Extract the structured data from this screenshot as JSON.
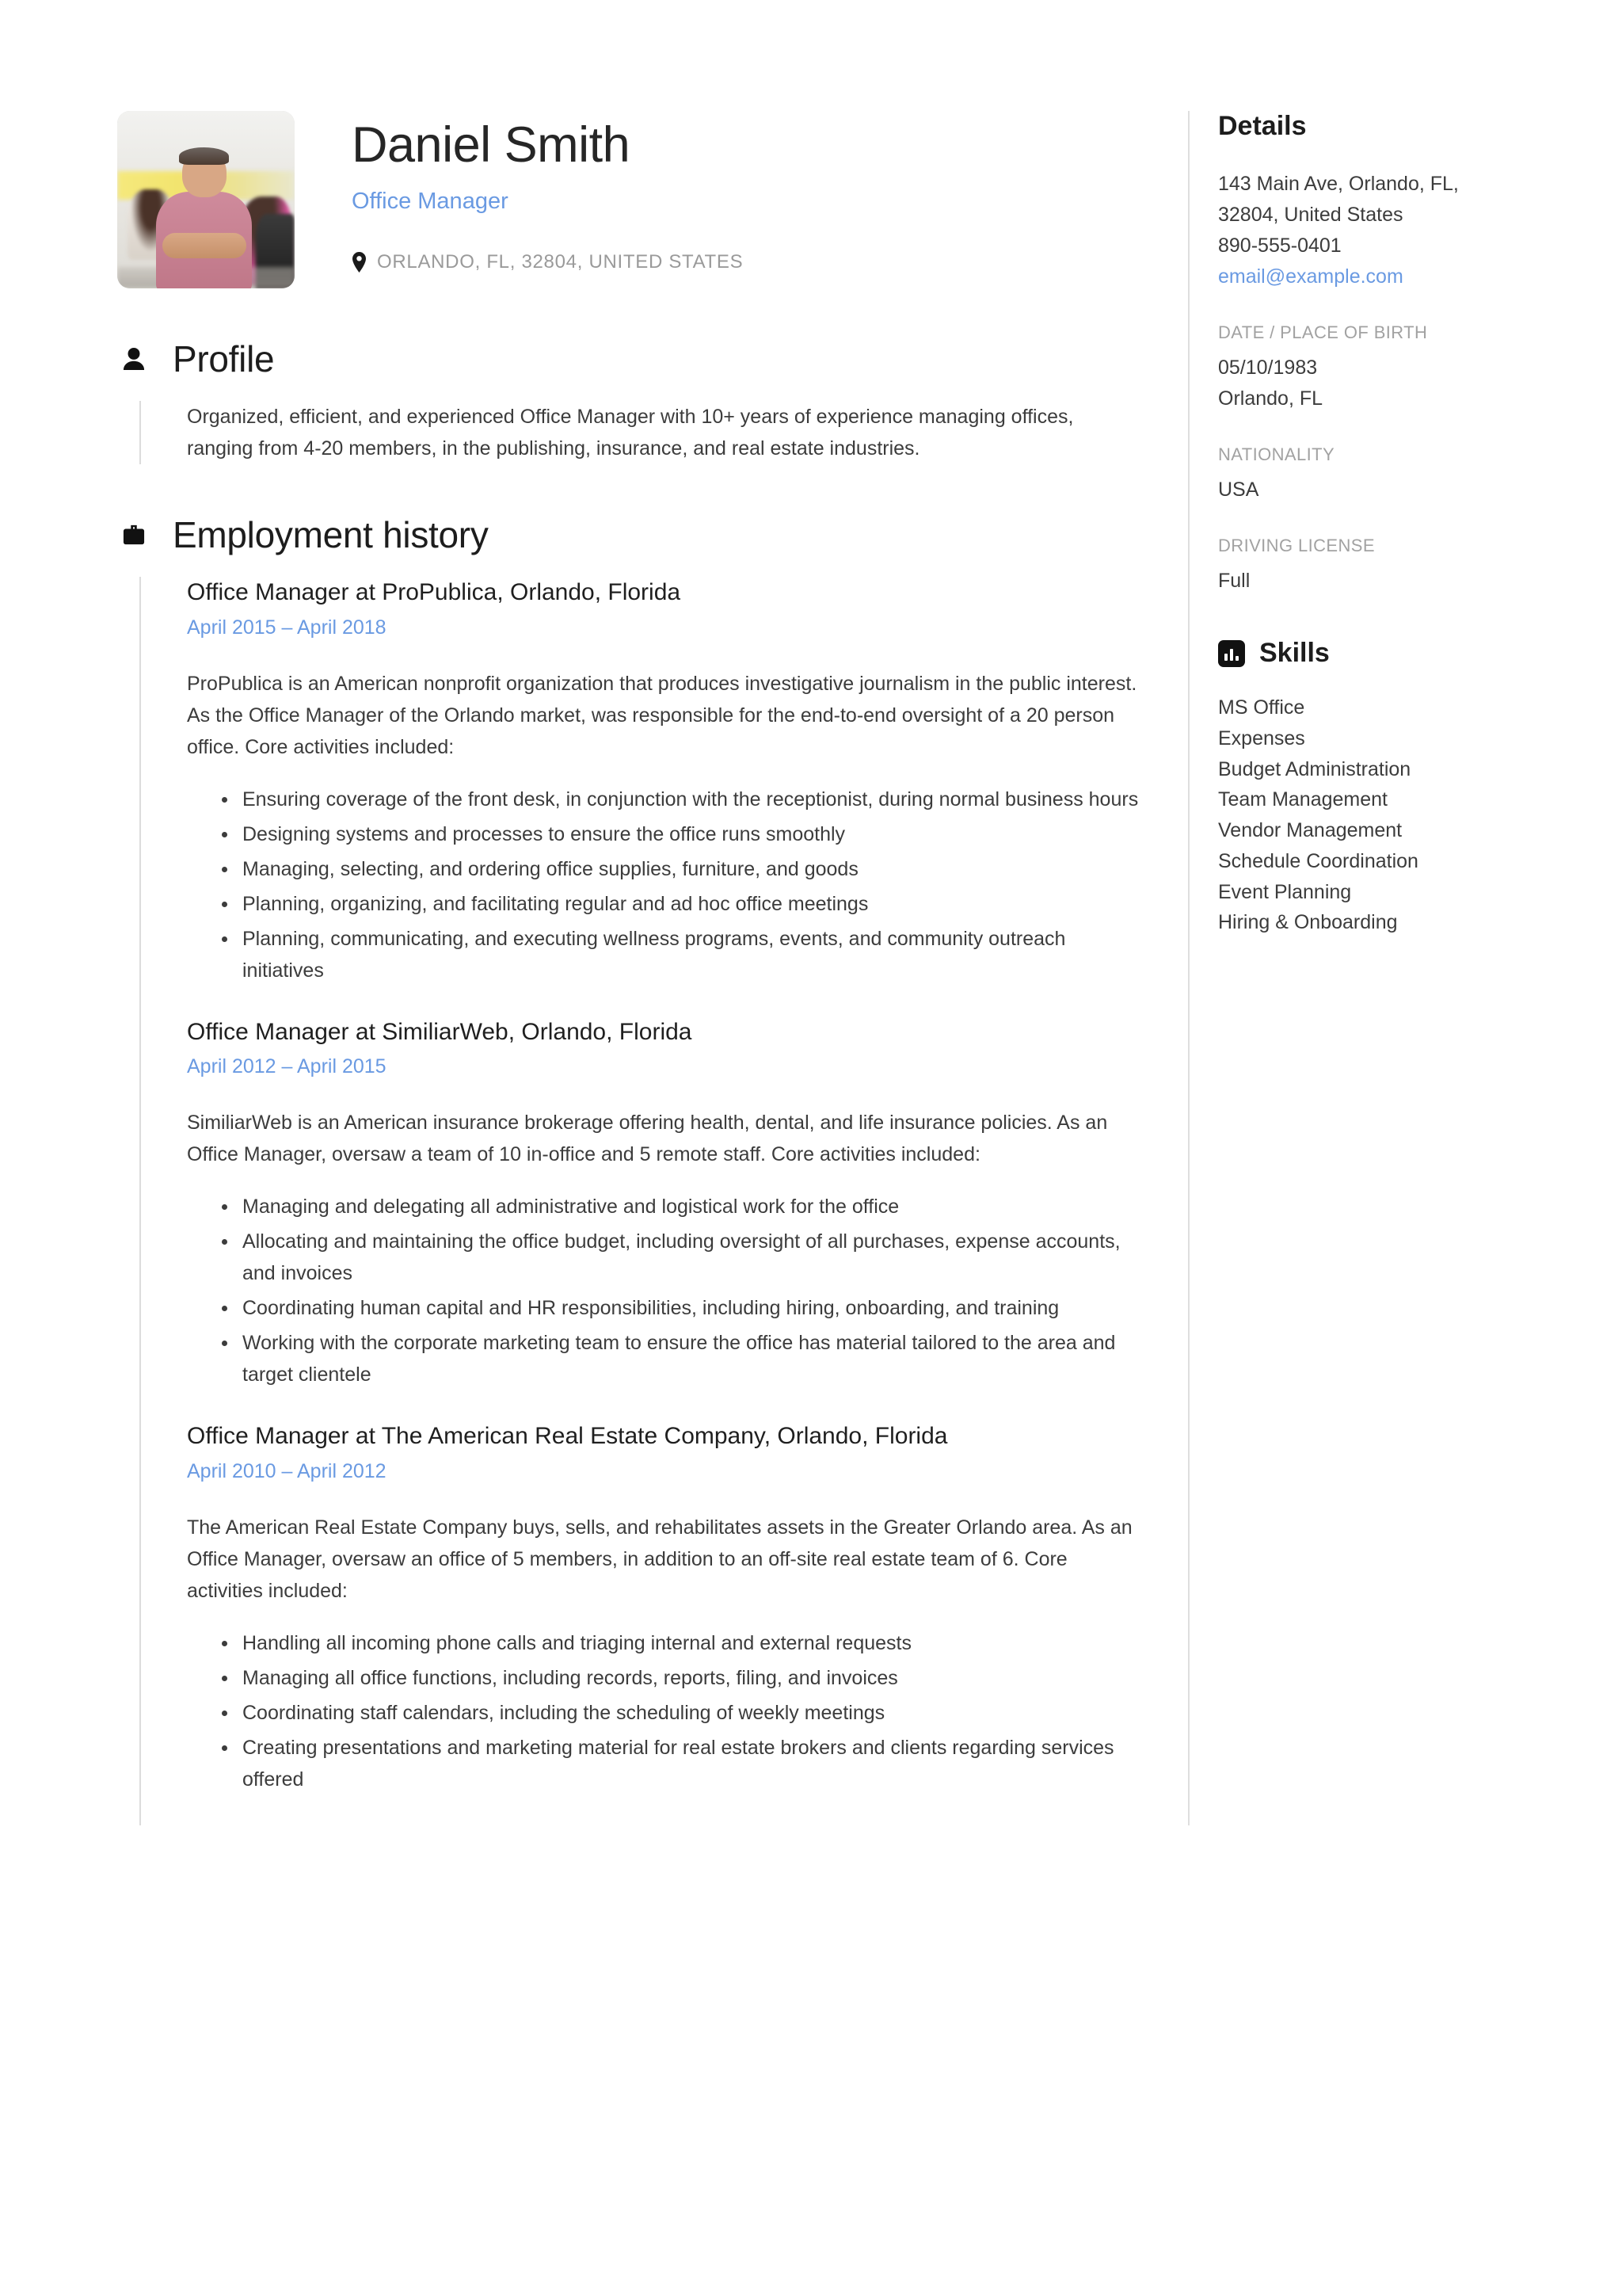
{
  "header": {
    "name": "Daniel Smith",
    "job_title": "Office Manager",
    "location": "ORLANDO, FL, 32804, UNITED STATES",
    "photo_alt": "profile-photo",
    "pin_icon": "map-pin-icon"
  },
  "accent_color": "#6a9ae2",
  "profile": {
    "icon": "person-icon",
    "title": "Profile",
    "text": "Organized, efficient, and experienced Office Manager with 10+ years of experience managing offices, ranging from 4-20 members, in the publishing, insurance, and real estate industries."
  },
  "employment": {
    "icon": "briefcase-icon",
    "title": "Employment history",
    "jobs": [
      {
        "heading": "Office Manager at ProPublica, Orlando, Florida",
        "dates": "April 2015  –  April 2018",
        "summary": "ProPublica is an American nonprofit organization that produces investigative journalism in the public interest. As the Office Manager of the Orlando market, was responsible for the end-to-end oversight of a 20 person office. Core activities included:",
        "bullets": [
          "Ensuring coverage of the front desk, in conjunction with the receptionist, during normal business hours",
          "Designing systems and processes to ensure the office runs smoothly",
          "Managing, selecting, and ordering office supplies, furniture, and goods",
          "Planning, organizing, and facilitating regular and ad hoc office meetings",
          "Planning, communicating, and executing wellness programs, events, and community outreach initiatives"
        ]
      },
      {
        "heading": "Office Manager at SimiliarWeb, Orlando, Florida",
        "dates": "April 2012  –  April 2015",
        "summary": "SimiliarWeb is an American insurance brokerage offering health, dental, and life insurance policies. As an Office Manager, oversaw a team of 10 in-office and 5 remote staff. Core activities included:",
        "bullets": [
          "Managing and delegating all administrative and logistical work for the office",
          "Allocating and maintaining the office budget, including oversight of all purchases, expense accounts, and invoices",
          "Coordinating human capital and HR responsibilities, including hiring, onboarding, and training",
          "Working with the corporate marketing team to ensure the office has material tailored to the area and target clientele"
        ]
      },
      {
        "heading": "Office Manager at The American Real Estate Company, Orlando, Florida",
        "dates": "April 2010  –  April 2012",
        "summary": "The American Real Estate Company buys, sells, and rehabilitates assets in the Greater Orlando area. As an Office Manager, oversaw an office of 5 members, in addition to an off-site real estate team of 6. Core activities included:",
        "bullets": [
          "Handling all incoming phone calls and triaging internal and external requests",
          "Managing all office functions, including records, reports, filing, and invoices",
          "Coordinating staff calendars, including the scheduling of weekly meetings",
          "Creating presentations and marketing material for real estate brokers and clients regarding services offered"
        ]
      }
    ]
  },
  "details": {
    "title": "Details",
    "address": "143 Main Ave, Orlando, FL, 32804, United States",
    "phone": "890-555-0401",
    "email": "email@example.com",
    "birth_label": "DATE / PLACE OF BIRTH",
    "birth_date": "05/10/1983",
    "birth_place": "Orlando, FL",
    "nationality_label": "NATIONALITY",
    "nationality": "USA",
    "license_label": "DRIVING LICENSE",
    "license": "Full"
  },
  "skills": {
    "icon": "bar-chart-icon",
    "title": "Skills",
    "items": [
      "MS Office",
      "Expenses",
      "Budget Administration",
      "Team Management",
      "Vendor Management",
      "Schedule Coordination",
      "Event Planning",
      "Hiring & Onboarding"
    ]
  }
}
